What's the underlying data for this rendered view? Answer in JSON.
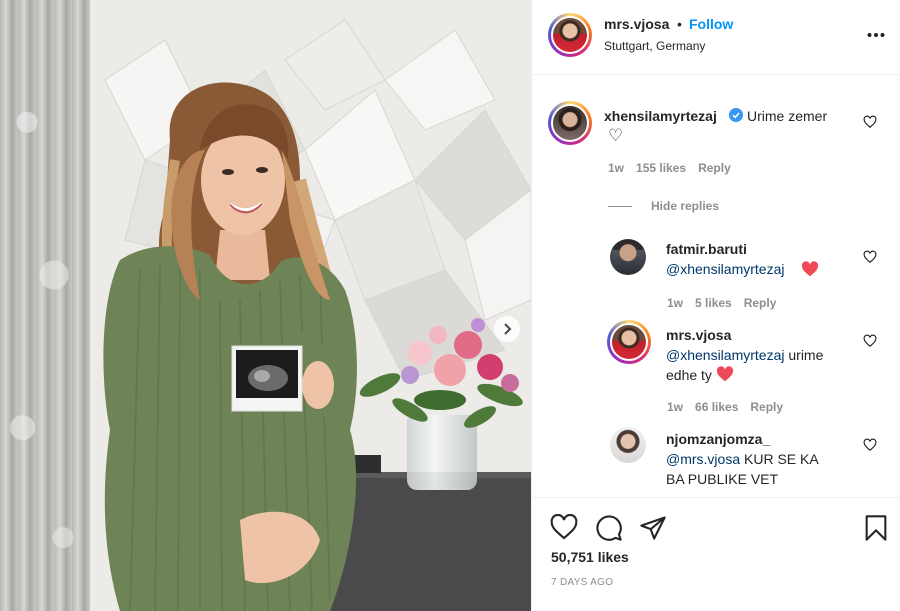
{
  "post": {
    "username": "mrs.vjosa",
    "dot": "•",
    "follow_label": "Follow",
    "location": "Stuttgart, Germany",
    "more": "•••",
    "likes": "50,751 likes",
    "date": "7 DAYS AGO"
  },
  "comments": [
    {
      "username": "xhensilamyrtezaj",
      "verified": true,
      "text": "Urime zemer",
      "emoji": "♡",
      "age": "1w",
      "likes": "155 likes",
      "reply": "Reply"
    }
  ],
  "hide_replies": "Hide replies",
  "replies": [
    {
      "username": "fatmir.baruti",
      "mention": "@xhensilamyrtezaj",
      "text": "",
      "emoji": "❤️",
      "age": "1w",
      "likes": "5 likes",
      "reply": "Reply"
    },
    {
      "username": "mrs.vjosa",
      "mention": "@xhensilamyrtezaj",
      "text": " urime",
      "text2": "edhe ty",
      "emoji": "❤️",
      "age": "1w",
      "likes": "66 likes",
      "reply": "Reply"
    },
    {
      "username": "njomzanjomza_",
      "mention": "@mrs.vjosa",
      "text": " KUR SE KA",
      "text2": "BA PUBLIKE VET"
    }
  ],
  "icons": [
    "heart-icon",
    "comment-icon",
    "share-icon",
    "bookmark-icon",
    "more-icon",
    "verified-icon",
    "chevron-right-icon"
  ],
  "colors": {
    "follow": "#0095f6",
    "mention": "#00376b",
    "verified": "#3897f0",
    "heart_red": "#ed4956"
  }
}
